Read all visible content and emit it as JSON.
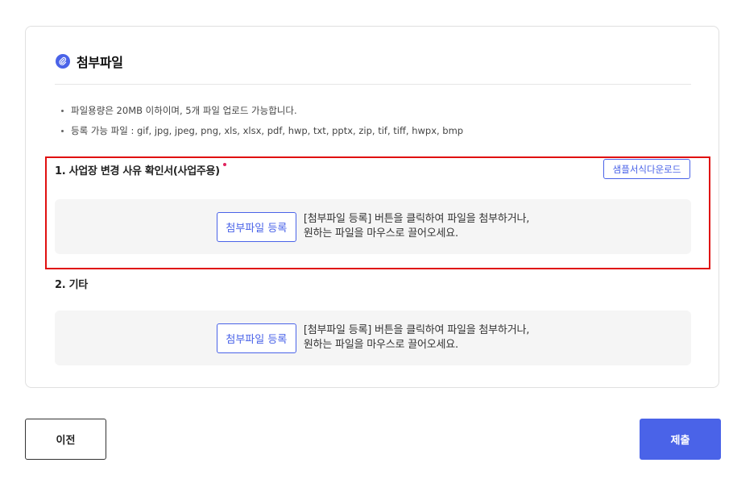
{
  "attachments": {
    "title": "첨부파일",
    "icon": "paperclip-icon",
    "notes": [
      "파일용량은 20MB 이하이며, 5개 파일 업로드 가능합니다.",
      "등록 가능 파일 : gif, jpg, jpeg, png, xls, xlsx, pdf, hwp, txt, pptx, zip, tif, tiff, hwpx, bmp"
    ],
    "fields": [
      {
        "label": "1. 사업장 변경 사유 확인서(사업주용)",
        "required": true,
        "sample_download_label": "샘플서식다운로드",
        "attach_button_label": "첨부파일 등록",
        "drop_text_line1": "[첨부파일 등록] 버튼을 클릭하여 파일을 첨부하거나,",
        "drop_text_line2": "원하는 파일을 마우스로 끌어오세요."
      },
      {
        "label": "2. 기타",
        "required": false,
        "attach_button_label": "첨부파일 등록",
        "drop_text_line1": "[첨부파일 등록] 버튼을 클릭하여 파일을 첨부하거나,",
        "drop_text_line2": "원하는 파일을 마우스로 끌어오세요."
      }
    ]
  },
  "footer": {
    "prev_label": "이전",
    "submit_label": "제출"
  },
  "colors": {
    "accent": "#4a63e8",
    "required_dot": "#e0245e",
    "highlight_border": "#e01010"
  }
}
